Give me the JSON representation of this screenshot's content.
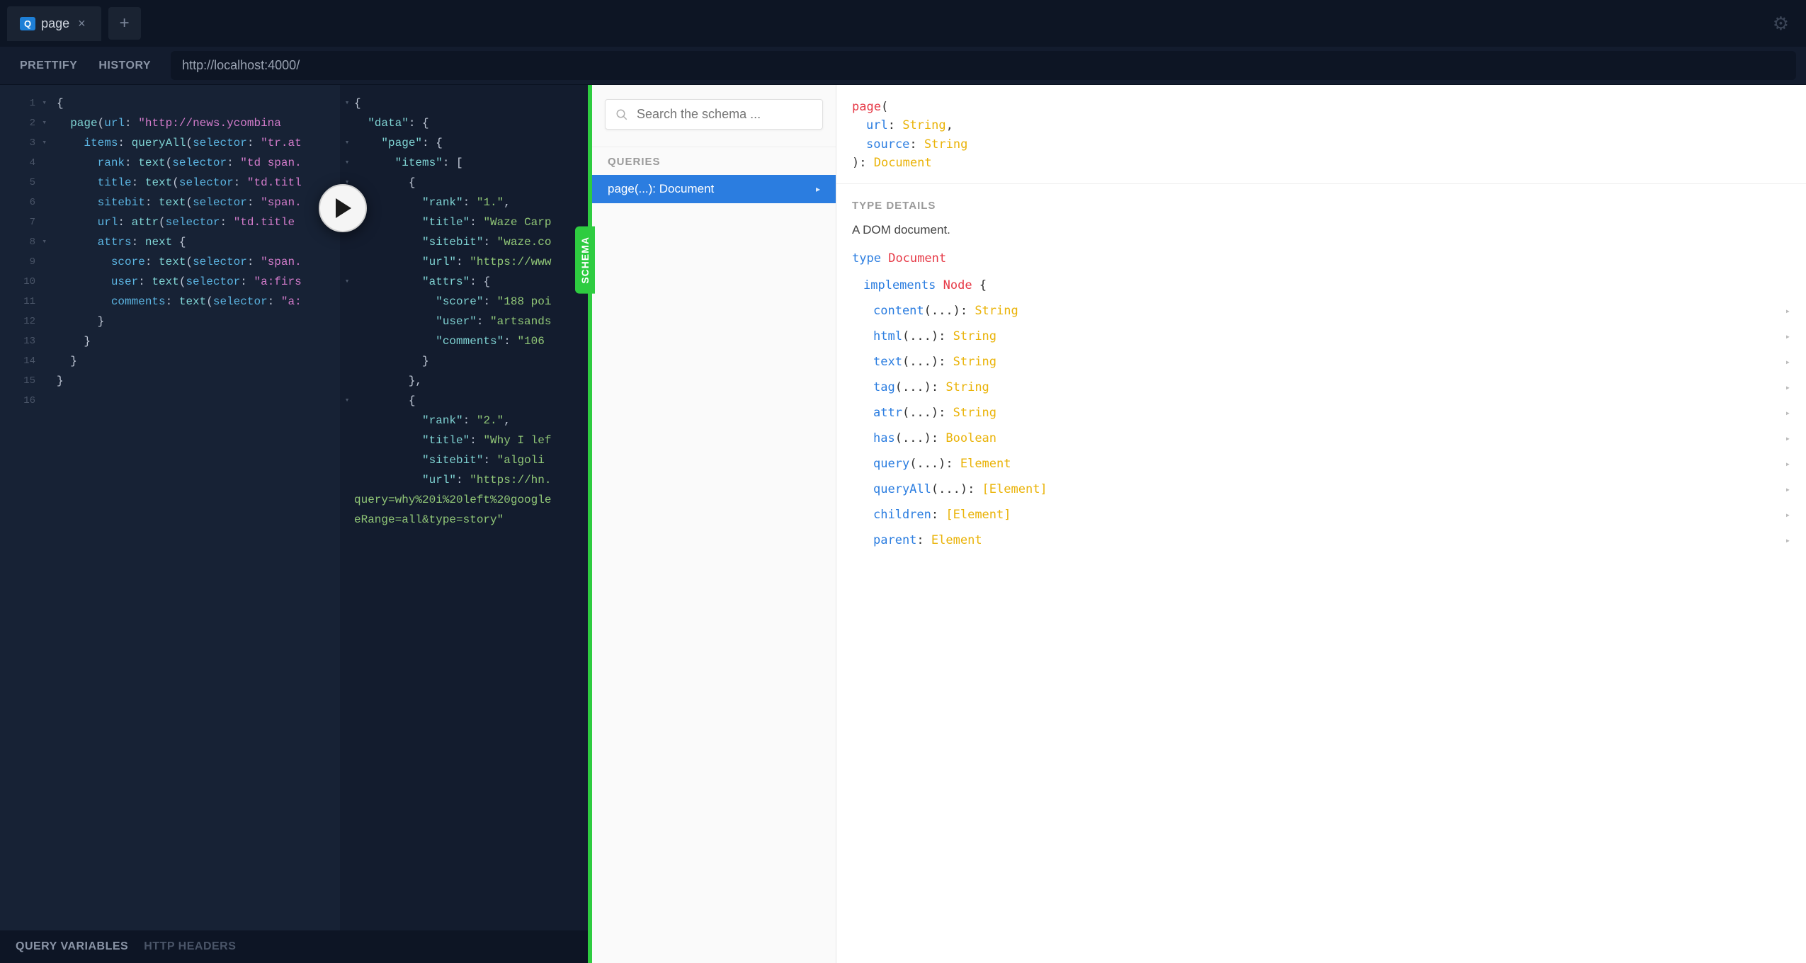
{
  "tabs": {
    "active": {
      "badge": "Q",
      "title": "page"
    }
  },
  "toolbar": {
    "prettify": "PRETTIFY",
    "history": "HISTORY",
    "endpoint": "http://localhost:4000/"
  },
  "editor": {
    "lines": [
      {
        "n": "1",
        "fold": true,
        "html": "<span class='punc'>{</span>"
      },
      {
        "n": "2",
        "fold": true,
        "html": "  <span class='fn'>page</span><span class='punc'>(</span><span class='arg'>url</span><span class='punc'>:</span> <span class='str'>\"http://news.ycombina</span>"
      },
      {
        "n": "3",
        "fold": true,
        "html": "    <span class='kw'>items</span><span class='punc'>:</span> <span class='fn'>queryAll</span><span class='punc'>(</span><span class='arg'>selector</span><span class='punc'>:</span> <span class='str'>\"tr.at</span>"
      },
      {
        "n": "4",
        "fold": false,
        "html": "      <span class='kw'>rank</span><span class='punc'>:</span> <span class='fn'>text</span><span class='punc'>(</span><span class='arg'>selector</span><span class='punc'>:</span> <span class='str'>\"td span.</span>"
      },
      {
        "n": "5",
        "fold": false,
        "html": "      <span class='kw'>title</span><span class='punc'>:</span> <span class='fn'>text</span><span class='punc'>(</span><span class='arg'>selector</span><span class='punc'>:</span> <span class='str'>\"td.titl</span>"
      },
      {
        "n": "6",
        "fold": false,
        "html": "      <span class='kw'>sitebit</span><span class='punc'>:</span> <span class='fn'>text</span><span class='punc'>(</span><span class='arg'>selector</span><span class='punc'>:</span> <span class='str'>\"span.</span>"
      },
      {
        "n": "7",
        "fold": false,
        "html": "      <span class='kw'>url</span><span class='punc'>:</span> <span class='fn'>attr</span><span class='punc'>(</span><span class='arg'>selector</span><span class='punc'>:</span> <span class='str'>\"td.title </span>"
      },
      {
        "n": "8",
        "fold": true,
        "html": "      <span class='kw'>attrs</span><span class='punc'>:</span> <span class='fn'>next</span> <span class='punc'>{</span>"
      },
      {
        "n": "9",
        "fold": false,
        "html": "        <span class='kw'>score</span><span class='punc'>:</span> <span class='fn'>text</span><span class='punc'>(</span><span class='arg'>selector</span><span class='punc'>:</span> <span class='str'>\"span.</span>"
      },
      {
        "n": "10",
        "fold": false,
        "html": "        <span class='kw'>user</span><span class='punc'>:</span> <span class='fn'>text</span><span class='punc'>(</span><span class='arg'>selector</span><span class='punc'>:</span> <span class='str'>\"a:firs</span>"
      },
      {
        "n": "11",
        "fold": false,
        "html": "        <span class='kw'>comments</span><span class='punc'>:</span> <span class='fn'>text</span><span class='punc'>(</span><span class='arg'>selector</span><span class='punc'>:</span> <span class='str'>\"a:</span>"
      },
      {
        "n": "12",
        "fold": false,
        "html": "      <span class='punc'>}</span>"
      },
      {
        "n": "13",
        "fold": false,
        "html": "    <span class='punc'>}</span>"
      },
      {
        "n": "14",
        "fold": false,
        "html": "  <span class='punc'>}</span>"
      },
      {
        "n": "15",
        "fold": false,
        "html": "<span class='punc'>}</span>"
      },
      {
        "n": "16",
        "fold": false,
        "html": ""
      }
    ]
  },
  "result": {
    "lines": [
      {
        "fold": true,
        "html": "<span class='punc'>{</span>"
      },
      {
        "fold": false,
        "html": "  <span class='key'>\"data\"</span><span class='punc'>: {</span>"
      },
      {
        "fold": true,
        "html": "    <span class='key'>\"page\"</span><span class='punc'>: {</span>"
      },
      {
        "fold": true,
        "html": "      <span class='key'>\"items\"</span><span class='punc'>: [</span>"
      },
      {
        "fold": true,
        "html": "        <span class='punc'>{</span>"
      },
      {
        "fold": false,
        "html": "          <span class='key'>\"rank\"</span><span class='punc'>:</span> <span class='val'>\"1.\"</span><span class='punc'>,</span>"
      },
      {
        "fold": false,
        "html": "          <span class='key'>\"title\"</span><span class='punc'>:</span> <span class='val'>\"Waze Carp</span>"
      },
      {
        "fold": false,
        "html": "          <span class='key'>\"sitebit\"</span><span class='punc'>:</span> <span class='val'>\"waze.co</span>"
      },
      {
        "fold": false,
        "html": "          <span class='key'>\"url\"</span><span class='punc'>:</span> <span class='val'>\"https://www</span>"
      },
      {
        "fold": true,
        "html": "          <span class='key'>\"attrs\"</span><span class='punc'>: {</span>"
      },
      {
        "fold": false,
        "html": "            <span class='key'>\"score\"</span><span class='punc'>:</span> <span class='val'>\"188 poi</span>"
      },
      {
        "fold": false,
        "html": "            <span class='key'>\"user\"</span><span class='punc'>:</span> <span class='val'>\"artsands</span>"
      },
      {
        "fold": false,
        "html": "            <span class='key'>\"comments\"</span><span class='punc'>:</span> <span class='val'>\"106 </span>"
      },
      {
        "fold": false,
        "html": "          <span class='punc'>}</span>"
      },
      {
        "fold": false,
        "html": "        <span class='punc'>},</span>"
      },
      {
        "fold": true,
        "html": "        <span class='punc'>{</span>"
      },
      {
        "fold": false,
        "html": "          <span class='key'>\"rank\"</span><span class='punc'>:</span> <span class='val'>\"2.\"</span><span class='punc'>,</span>"
      },
      {
        "fold": false,
        "html": "          <span class='key'>\"title\"</span><span class='punc'>:</span> <span class='val'>\"Why I lef</span>"
      },
      {
        "fold": false,
        "html": "          <span class='key'>\"sitebit\"</span><span class='punc'>:</span> <span class='val'>\"algoli</span>"
      },
      {
        "fold": false,
        "html": "          <span class='key'>\"url\"</span><span class='punc'>:</span> <span class='val'>\"https://hn.</span>"
      },
      {
        "fold": false,
        "html": "<span class='val'>query=why%20i%20left%20google</span>"
      },
      {
        "fold": false,
        "html": "<span class='val'>eRange=all&amp;type=story\"</span>"
      }
    ]
  },
  "schema_tab": "SCHEMA",
  "schema": {
    "search_placeholder": "Search the schema ...",
    "section_queries": "QUERIES",
    "queries": [
      {
        "name": "page",
        "args": "(...)",
        "ret": "Document"
      }
    ]
  },
  "docs": {
    "signature": {
      "name": "page",
      "args": [
        {
          "name": "url",
          "type": "String"
        },
        {
          "name": "source",
          "type": "String"
        }
      ],
      "ret": "Document"
    },
    "type_details_title": "TYPE DETAILS",
    "description": "A DOM document.",
    "type_kw": "type",
    "type_name": "Document",
    "implements_kw": "implements",
    "implements_type": "Node",
    "fields": [
      {
        "name": "content",
        "args": "(...)",
        "type": "String"
      },
      {
        "name": "html",
        "args": "(...)",
        "type": "String"
      },
      {
        "name": "text",
        "args": "(...)",
        "type": "String"
      },
      {
        "name": "tag",
        "args": "(...)",
        "type": "String"
      },
      {
        "name": "attr",
        "args": "(...)",
        "type": "String"
      },
      {
        "name": "has",
        "args": "(...)",
        "type": "Boolean"
      },
      {
        "name": "query",
        "args": "(...)",
        "type": "Element"
      },
      {
        "name": "queryAll",
        "args": "(...)",
        "type": "[Element]"
      },
      {
        "name": "children",
        "args": "",
        "type": "[Element]"
      },
      {
        "name": "parent",
        "args": "",
        "type": "Element"
      }
    ]
  },
  "bottombar": {
    "vars": "QUERY VARIABLES",
    "headers": "HTTP HEADERS"
  }
}
